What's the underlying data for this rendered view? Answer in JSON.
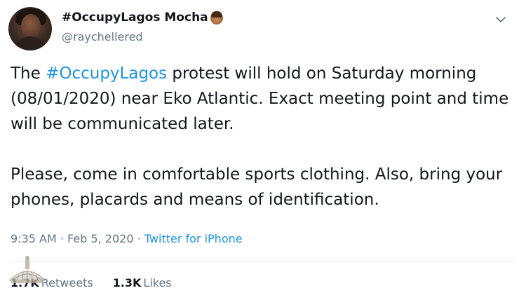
{
  "tweet": {
    "display_name": "#OccupyLagos Mocha",
    "handle": "@raychellered",
    "body": {
      "p1_before": "The ",
      "p1_hashtag": "#OccupyLagos",
      "p1_after": " protest will hold on Saturday morning (08/01/2020) near Eko Atlantic. Exact meeting point and time will be communicated later.",
      "p2": "Please, come in comfortable sports clothing. Also, bring your phones, placards and means of identification."
    },
    "meta": {
      "time": "9:35 AM",
      "separator1": " · ",
      "date": "Feb 5, 2020",
      "separator2": " · ",
      "source": "Twitter for iPhone"
    },
    "stats": {
      "retweets_count": "1.7K",
      "retweets_label": "Retweets",
      "likes_count": "1.3K",
      "likes_label": "Likes"
    }
  },
  "icons": {
    "menu": "chevron-down-icon",
    "name_emoji": "woman-emoji-icon",
    "watermark": "crown-watermark-icon"
  },
  "colors": {
    "link": "#1b95e0",
    "secondary_text": "#657786",
    "primary_text": "#14171a"
  }
}
